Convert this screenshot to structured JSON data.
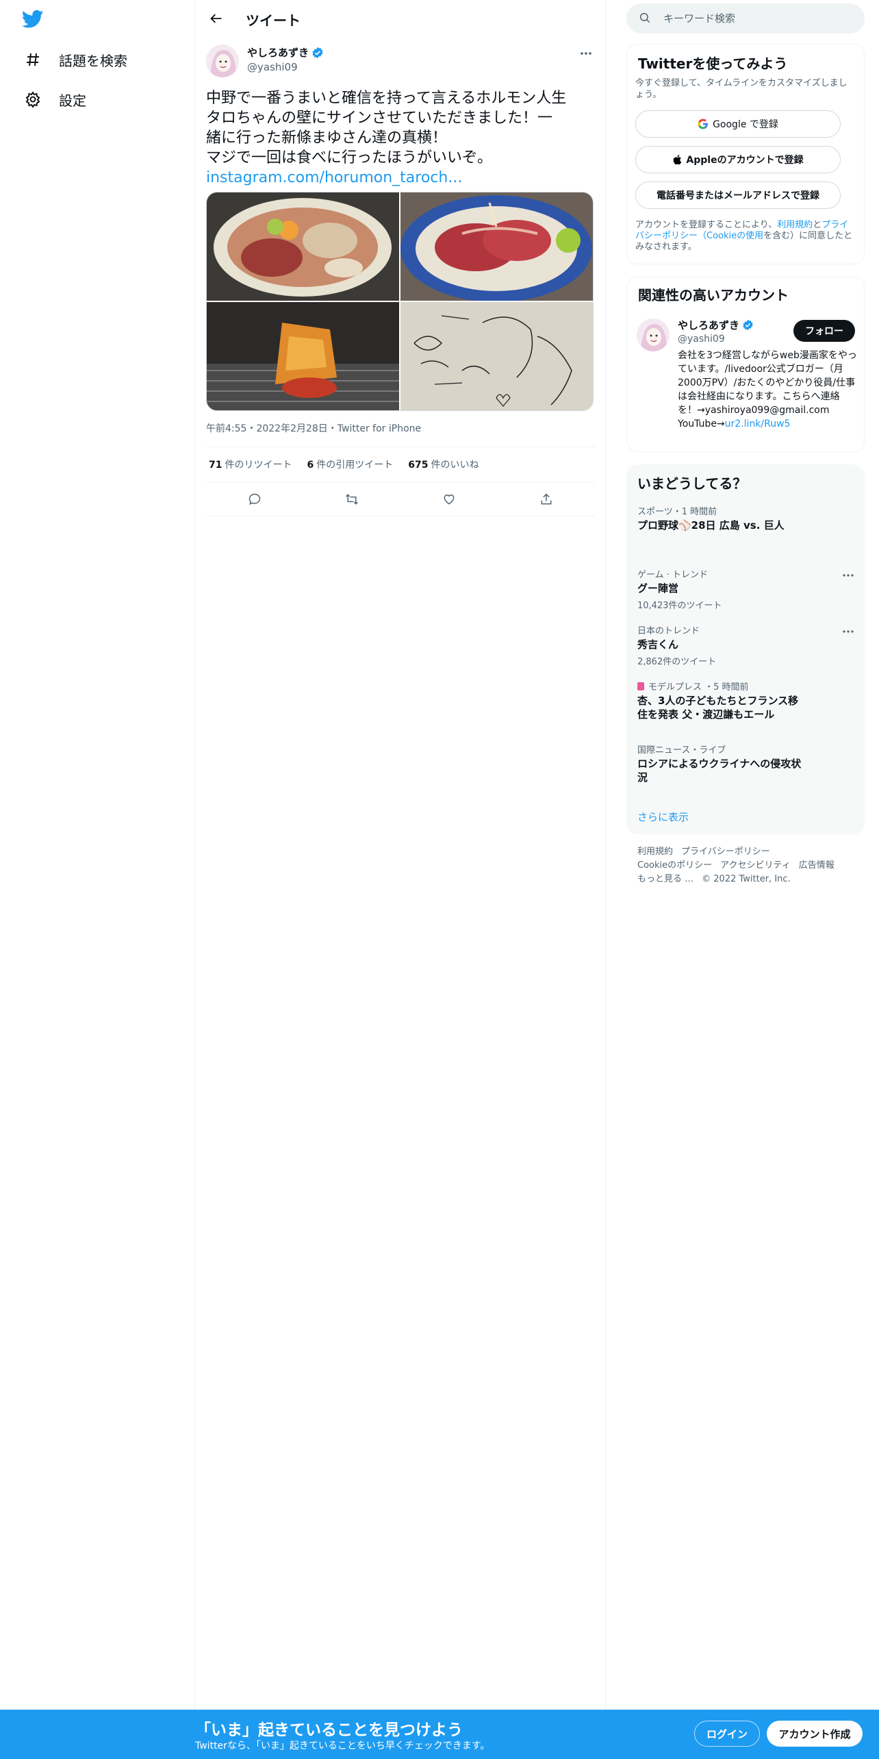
{
  "nav": {
    "logo": "twitter-bird-icon",
    "items": [
      {
        "label": "話題を検索",
        "icon": "hashtag-icon"
      },
      {
        "label": "設定",
        "icon": "gear-icon"
      }
    ]
  },
  "header": {
    "title": "ツイート"
  },
  "tweet": {
    "author_name": "やしろあずき",
    "author_handle": "@yashi09",
    "text_lines": [
      "中野で一番うまいと確信を持って言えるホルモン人生",
      "タロちゃんの壁にサインさせていただきました！一",
      "緒に行った新條まゆさん達の真横！",
      "マジで一回は食べに行ったほうがいいぞ。"
    ],
    "link": "instagram.com/horumon_taroch...",
    "meta": "午前4:55・2022年2月28日・Twitter for iPhone",
    "retweets_count": "71",
    "retweets_label": "件のリツイート",
    "quotes_count": "6",
    "quotes_label": "件の引用ツイート",
    "likes_count": "675",
    "likes_label": "件のいいね"
  },
  "search": {
    "placeholder": "キーワード検索"
  },
  "signup": {
    "title": "Twitterを使ってみよう",
    "desc": "今すぐ登録して、タイムラインをカスタマイズしましょう。",
    "google": "Google で登録",
    "apple": "Appleのアカウントで登録",
    "phone": "電話番号またはメールアドレスで登録",
    "terms_pre": "アカウントを登録することにより、",
    "terms_link1": "利用規約",
    "terms_mid": "と",
    "terms_link2": "プライバシーポリシー",
    "terms_link3": "（Cookieの使用",
    "terms_post": "を含む）に同意したとみなされます。"
  },
  "related": {
    "title": "関連性の高いアカウント",
    "name": "やしろあずき",
    "handle": "@yashi09",
    "follow": "フォロー",
    "bio": "会社を3つ経営しながらweb漫画家をやっています。/livedoor公式ブロガー（月2000万PV）/おたくのやどかり役員/仕事は会社経由になります。こちらへ連絡を！→yashiroya099@gmail.com YouTube→",
    "bio_link": "ur2.link/Ruw5"
  },
  "trends": {
    "title": "いまどうしてる？",
    "items": [
      {
        "meta": "スポーツ・1 時間前",
        "name": "プロ野球⚾28日 広島 vs. 巨人",
        "count": ""
      },
      {
        "meta": "ゲーム · トレンド",
        "name": "グー陣営",
        "count": "10,423件のツイート"
      },
      {
        "meta": "日本のトレンド",
        "name": "秀吉くん",
        "count": "2,862件のツイート"
      },
      {
        "meta": "モデルプレス ・5 時間前",
        "name": "杏、3人の子どもたちとフランス移住を発表 父・渡辺謙もエール",
        "count": ""
      },
      {
        "meta": "国際ニュース・ライブ",
        "name": "ロシアによるウクライナへの侵攻状況",
        "count": ""
      }
    ],
    "show_more": "さらに表示"
  },
  "footer": {
    "links": [
      "利用規約",
      "プライバシーポリシー",
      "Cookieのポリシー",
      "アクセシビリティ",
      "広告情報",
      "もっと見る …",
      "© 2022 Twitter, Inc."
    ]
  },
  "bottom_bar": {
    "title": "「いま」起きていることを見つけよう",
    "subtitle": "Twitterなら、「いま」起きていることをいち早くチェックできます。",
    "login": "ログイン",
    "signup": "アカウント作成"
  },
  "colors": {
    "accent": "#1d9bf0",
    "text": "#0f1419",
    "muted": "#536471",
    "border": "#eff3f4"
  }
}
